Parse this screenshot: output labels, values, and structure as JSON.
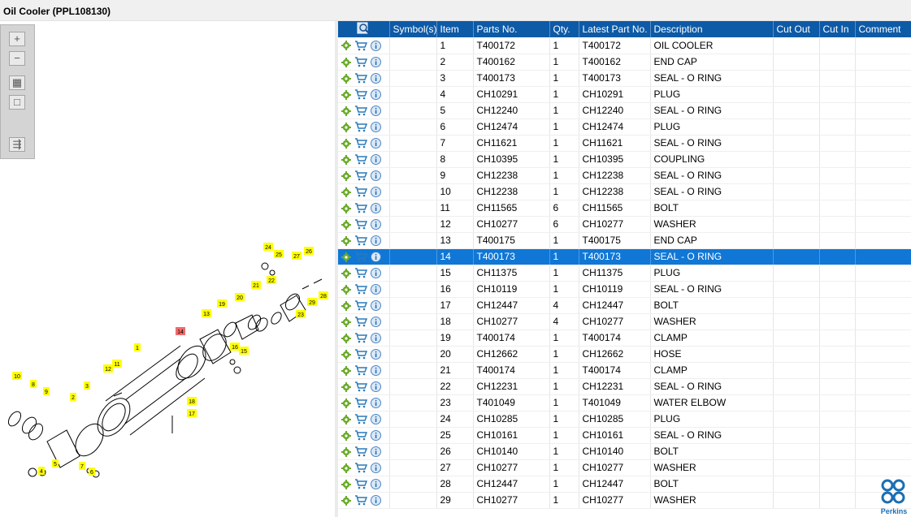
{
  "window": {
    "title": "Oil Cooler (PPL108130)"
  },
  "toolbar": {
    "buttons": [
      {
        "name": "zoom-in-button",
        "icon": "plus-icon",
        "glyph": "+"
      },
      {
        "name": "zoom-out-button",
        "icon": "minus-icon",
        "glyph": "−"
      },
      {
        "name": "fit-all-button",
        "icon": "grid-icon",
        "glyph": "▦"
      },
      {
        "name": "fit-page-button",
        "icon": "square-icon",
        "glyph": "□"
      },
      {
        "name": "export-button",
        "icon": "list-arrow-icon",
        "glyph": "⇶"
      }
    ]
  },
  "diagram": {
    "highlighted_callout": "14",
    "callouts": [
      "1",
      "2",
      "3",
      "4",
      "5",
      "6",
      "7",
      "8",
      "9",
      "10",
      "11",
      "12",
      "13",
      "14",
      "15",
      "16",
      "17",
      "18",
      "19",
      "20",
      "21",
      "22",
      "23",
      "24",
      "25",
      "26",
      "27",
      "28",
      "29"
    ]
  },
  "grid": {
    "columns": [
      "",
      "Symbol(s)",
      "Item",
      "Parts No.",
      "Qty.",
      "Latest Part No.",
      "Description",
      "Cut Out",
      "Cut In",
      "Comment"
    ],
    "selected_item": "14",
    "rows": [
      {
        "item": "1",
        "parts_no": "T400172",
        "qty": "1",
        "latest": "T400172",
        "desc": "OIL COOLER"
      },
      {
        "item": "2",
        "parts_no": "T400162",
        "qty": "1",
        "latest": "T400162",
        "desc": "END CAP"
      },
      {
        "item": "3",
        "parts_no": "T400173",
        "qty": "1",
        "latest": "T400173",
        "desc": "SEAL - O RING"
      },
      {
        "item": "4",
        "parts_no": "CH10291",
        "qty": "1",
        "latest": "CH10291",
        "desc": "PLUG"
      },
      {
        "item": "5",
        "parts_no": "CH12240",
        "qty": "1",
        "latest": "CH12240",
        "desc": "SEAL - O RING"
      },
      {
        "item": "6",
        "parts_no": "CH12474",
        "qty": "1",
        "latest": "CH12474",
        "desc": "PLUG"
      },
      {
        "item": "7",
        "parts_no": "CH11621",
        "qty": "1",
        "latest": "CH11621",
        "desc": "SEAL - O RING"
      },
      {
        "item": "8",
        "parts_no": "CH10395",
        "qty": "1",
        "latest": "CH10395",
        "desc": "COUPLING"
      },
      {
        "item": "9",
        "parts_no": "CH12238",
        "qty": "1",
        "latest": "CH12238",
        "desc": "SEAL - O RING"
      },
      {
        "item": "10",
        "parts_no": "CH12238",
        "qty": "1",
        "latest": "CH12238",
        "desc": "SEAL - O RING"
      },
      {
        "item": "11",
        "parts_no": "CH11565",
        "qty": "6",
        "latest": "CH11565",
        "desc": "BOLT"
      },
      {
        "item": "12",
        "parts_no": "CH10277",
        "qty": "6",
        "latest": "CH10277",
        "desc": "WASHER"
      },
      {
        "item": "13",
        "parts_no": "T400175",
        "qty": "1",
        "latest": "T400175",
        "desc": "END CAP"
      },
      {
        "item": "14",
        "parts_no": "T400173",
        "qty": "1",
        "latest": "T400173",
        "desc": "SEAL - O RING"
      },
      {
        "item": "15",
        "parts_no": "CH11375",
        "qty": "1",
        "latest": "CH11375",
        "desc": "PLUG"
      },
      {
        "item": "16",
        "parts_no": "CH10119",
        "qty": "1",
        "latest": "CH10119",
        "desc": "SEAL - O RING"
      },
      {
        "item": "17",
        "parts_no": "CH12447",
        "qty": "4",
        "latest": "CH12447",
        "desc": "BOLT"
      },
      {
        "item": "18",
        "parts_no": "CH10277",
        "qty": "4",
        "latest": "CH10277",
        "desc": "WASHER"
      },
      {
        "item": "19",
        "parts_no": "T400174",
        "qty": "1",
        "latest": "T400174",
        "desc": "CLAMP"
      },
      {
        "item": "20",
        "parts_no": "CH12662",
        "qty": "1",
        "latest": "CH12662",
        "desc": "HOSE"
      },
      {
        "item": "21",
        "parts_no": "T400174",
        "qty": "1",
        "latest": "T400174",
        "desc": "CLAMP"
      },
      {
        "item": "22",
        "parts_no": "CH12231",
        "qty": "1",
        "latest": "CH12231",
        "desc": "SEAL - O RING"
      },
      {
        "item": "23",
        "parts_no": "T401049",
        "qty": "1",
        "latest": "T401049",
        "desc": "WATER ELBOW"
      },
      {
        "item": "24",
        "parts_no": "CH10285",
        "qty": "1",
        "latest": "CH10285",
        "desc": "PLUG"
      },
      {
        "item": "25",
        "parts_no": "CH10161",
        "qty": "1",
        "latest": "CH10161",
        "desc": "SEAL - O RING"
      },
      {
        "item": "26",
        "parts_no": "CH10140",
        "qty": "1",
        "latest": "CH10140",
        "desc": "BOLT"
      },
      {
        "item": "27",
        "parts_no": "CH10277",
        "qty": "1",
        "latest": "CH10277",
        "desc": "WASHER"
      },
      {
        "item": "28",
        "parts_no": "CH12447",
        "qty": "1",
        "latest": "CH12447",
        "desc": "BOLT"
      },
      {
        "item": "29",
        "parts_no": "CH10277",
        "qty": "1",
        "latest": "CH10277",
        "desc": "WASHER"
      }
    ]
  },
  "row_icons": [
    "gear-icon",
    "cart-icon",
    "info-icon"
  ],
  "logo": {
    "text": "Perkins",
    "icon": "perkins-logo-icon"
  },
  "colors": {
    "header": "#0d5aa7",
    "selected": "#1077d6",
    "callout": "#ffff00",
    "callout_highlight": "#f06b6b",
    "gear": "#6aaa2a",
    "cart": "#2a7ab8"
  }
}
